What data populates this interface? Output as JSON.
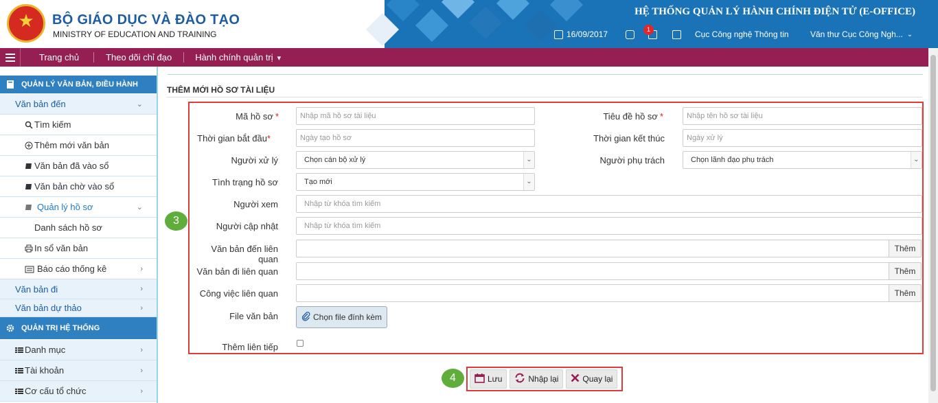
{
  "header": {
    "brand_title": "BỘ GIÁO DỤC VÀ ĐÀO TẠO",
    "brand_subtitle": "MINISTRY OF EDUCATION AND TRAINING",
    "system_title": "HỆ THỐNG QUẢN LÝ HÀNH CHÍNH ĐIỆN TỬ (E-OFFICE)",
    "date": "16/09/2017",
    "notification_count": "1",
    "organization": "Cục Công nghệ Thông tin",
    "user": "Văn thư Cục Công Ngh..."
  },
  "nav": {
    "items": [
      "Trang chủ",
      "Theo dõi chỉ đạo",
      "Hành chính quản trị"
    ]
  },
  "sidebar": {
    "section1": "QUẢN LÝ VĂN BẢN, ĐIỀU HÀNH",
    "van_ban_den": "Văn bản đến",
    "tim_kiem": "Tìm kiếm",
    "them_moi_van_ban": "Thêm mới văn bản",
    "van_ban_da_vao_so": "Văn bản đã vào sổ",
    "van_ban_cho_vao_so": "Văn bản chờ vào sổ",
    "quan_ly_ho_so": "Quản lý hồ sơ",
    "danh_sach_ho_so": "Danh sách hồ sơ",
    "in_so_van_ban": "In sổ văn bản",
    "bao_cao_thong_ke": "Báo cáo thống kê",
    "van_ban_di": "Văn bản đi",
    "van_ban_du_thao": "Văn bản dự thảo",
    "section2": "QUẢN TRỊ HỆ THỐNG",
    "danh_muc": "Danh mục",
    "tai_khoan": "Tài khoản",
    "co_cau_to_chuc": "Cơ cấu tổ chức"
  },
  "form": {
    "title": "THÊM MỚI HỒ SƠ TÀI LIỆU",
    "ma_ho_so_label": "Mã hồ sơ",
    "ma_ho_so_placeholder": "Nhập mã hồ sơ tài liệu",
    "tieu_de_label": "Tiêu đề hồ sơ",
    "tieu_de_placeholder": "Nhập tên hồ sơ tài liệu",
    "tg_bat_dau_label": "Thời gian bắt đầu",
    "tg_bat_dau_placeholder": "Ngày tạo hồ sơ",
    "tg_ket_thuc_label": "Thời gian kết thúc",
    "tg_ket_thuc_placeholder": "Ngày xử lý",
    "nguoi_xu_ly_label": "Người xử lý",
    "nguoi_xu_ly_value": "Chọn cán bộ xử lý",
    "nguoi_phu_trach_label": "Người phụ trách",
    "nguoi_phu_trach_value": "Chọn lãnh đạo phụ trách",
    "tinh_trang_label": "Tình trạng hồ sơ",
    "tinh_trang_value": "Tạo mới",
    "nguoi_xem_label": "Người xem",
    "nguoi_xem_placeholder": "Nhập từ khóa tìm kiếm",
    "nguoi_cap_nhat_label": "Người cập nhật",
    "nguoi_cap_nhat_placeholder": "Nhập từ khóa tìm kiếm",
    "vb_den_lq_label": "Văn bản đến liên quan",
    "vb_di_lq_label": "Văn bản đi liên quan",
    "cong_viec_lq_label": "Công việc liên quan",
    "them_label": "Thêm",
    "file_label": "File văn bản",
    "file_button": "Chọn file đính kèm",
    "them_lien_tiep_label": "Thêm liên tiếp",
    "required_mark": "*"
  },
  "actions": {
    "save": "Lưu",
    "reset": "Nhập lại",
    "back": "Quay lại"
  },
  "steps": {
    "form_step": "3",
    "action_step": "4"
  },
  "colors": {
    "header_blue": "#1b73b7",
    "navbar": "#951e52",
    "sidebar_section": "#2f80c0",
    "annotation_red": "#e03a3a",
    "step_green": "#5fad3b"
  }
}
